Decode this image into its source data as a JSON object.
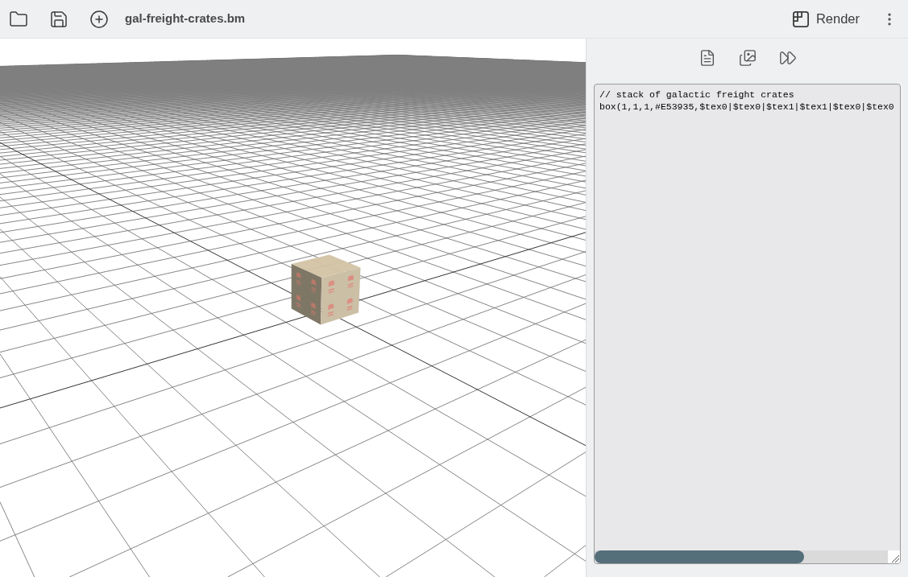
{
  "toolbar": {
    "file_name": "gal-freight-crates.bm",
    "render_button": "Render"
  },
  "editor": {
    "lines": [
      "// stack of galactic freight crates",
      "box(1,1,1,#E53935,$tex0|$tex0|$tex1|$tex1|$tex0|$tex0"
    ]
  }
}
